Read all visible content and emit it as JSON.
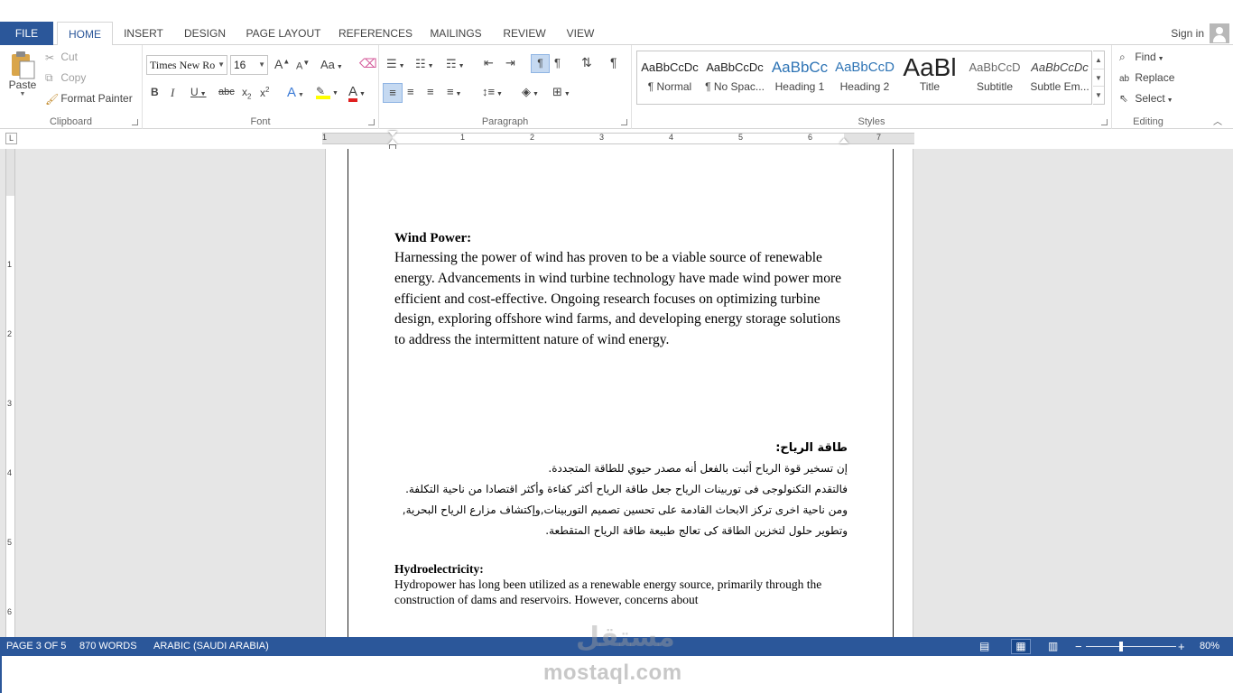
{
  "tabs": {
    "file": "FILE",
    "home": "HOME",
    "insert": "INSERT",
    "design": "DESIGN",
    "page_layout": "PAGE LAYOUT",
    "references": "REFERENCES",
    "mailings": "MAILINGS",
    "review": "REVIEW",
    "view": "VIEW",
    "sign_in": "Sign in"
  },
  "clipboard": {
    "label": "Clipboard",
    "paste": "Paste",
    "cut": "Cut",
    "copy": "Copy",
    "format_painter": "Format Painter"
  },
  "font": {
    "label": "Font",
    "family": "Times New Ro",
    "size": "16",
    "grow": "A",
    "shrink": "A",
    "change_case": "Aa",
    "bold": "B",
    "italic": "I",
    "underline": "U",
    "strike": "abc",
    "subscript": "x",
    "superscript": "x",
    "effects": "A",
    "font_color": "A"
  },
  "paragraph": {
    "label": "Paragraph"
  },
  "styles": {
    "label": "Styles",
    "items": [
      {
        "sample": "AaBbCcDc",
        "name": "¶ Normal"
      },
      {
        "sample": "AaBbCcDc",
        "name": "¶ No Spac..."
      },
      {
        "sample": "AaBbCc",
        "name": "Heading 1"
      },
      {
        "sample": "AaBbCcD",
        "name": "Heading 2"
      },
      {
        "sample": "AaBl",
        "name": "Title"
      },
      {
        "sample": "AaBbCcD",
        "name": "Subtitle"
      },
      {
        "sample": "AaBbCcDc",
        "name": "Subtle Em..."
      }
    ]
  },
  "editing": {
    "label": "Editing",
    "find": "Find",
    "replace": "Replace",
    "select": "Select"
  },
  "ruler": {
    "corner": "L",
    "h_numbers": [
      "1",
      "1",
      "2",
      "3",
      "4",
      "5",
      "6",
      "7"
    ],
    "v_numbers": [
      "1",
      "2",
      "3",
      "4",
      "5",
      "6"
    ]
  },
  "document": {
    "heading_en": "Wind Power:",
    "para_en": "Harnessing the power of wind has proven to be a viable source of renewable energy. Advancements in wind turbine technology have made wind power more efficient and cost-effective. Ongoing research focuses on optimizing turbine design, exploring offshore wind farms, and developing energy storage solutions to address the intermittent nature of wind energy.",
    "heading_ar": "طاقة الرياح:",
    "para_ar_1": "إن تسخير قوة الرياح أثبت بالفعل أنه مصدر حيوي للطاقة المتجددة.",
    "para_ar_2": "فالتقدم التكنولوجى فى توربينات الرياح جعل طاقة الرياح أكثر كفاءة وأكثر اقتصادا من ناحية التكلفة.",
    "para_ar_3": "ومن ناحية اخرى تركز الابحاث القادمة على تحسين تصميم التوربينات,وإكتشاف مزارع الرياح البحرية, وتطوير حلول لتخزين الطاقة كى تعالج طبيعة طاقة الرياح المتقطعة.",
    "heading_en2": "Hydroelectricity:",
    "para_en2": "Hydropower has long been utilized as a renewable energy source, primarily through the construction of dams and reservoirs. However, concerns about"
  },
  "status": {
    "page": "PAGE 3 OF 5",
    "words": "870 WORDS",
    "language": "ARABIC (SAUDI ARABIA)",
    "zoom": "80%",
    "zoom_level_percent": 80
  },
  "watermark": {
    "latin": "mostaql.com",
    "arabic": "مستقل"
  }
}
